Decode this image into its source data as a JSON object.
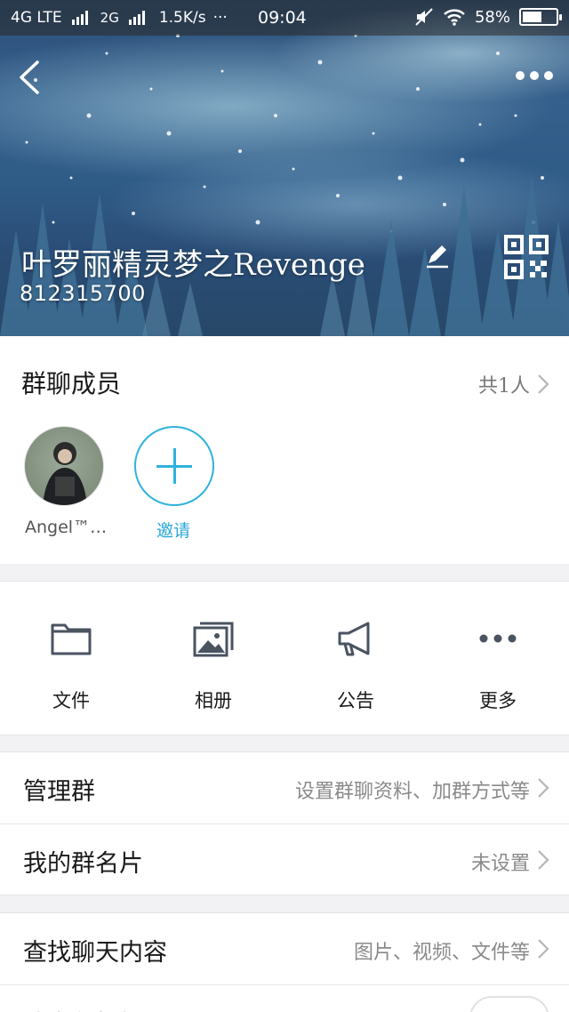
{
  "status_bar": {
    "network1": "4G LTE",
    "network2": "2G",
    "speed": "1.5K/s",
    "dots": "···",
    "time": "09:04",
    "battery": "58%",
    "battery_level": 0.58
  },
  "header": {
    "group_name": "叶罗丽精灵梦之Revenge",
    "group_id": "812315700"
  },
  "members": {
    "title": "群聊成员",
    "count": "共1人",
    "list": [
      {
        "name": "Angel™…"
      }
    ],
    "invite_label": "邀请"
  },
  "actions": [
    {
      "label": "文件",
      "icon": "folder-icon"
    },
    {
      "label": "相册",
      "icon": "photo-album-icon"
    },
    {
      "label": "公告",
      "icon": "megaphone-icon"
    },
    {
      "label": "更多",
      "icon": "more-dots-icon"
    }
  ],
  "settings": {
    "manage": {
      "title": "管理群",
      "value": "设置群聊资料、加群方式等"
    },
    "card": {
      "title": "我的群名片",
      "value": "未设置"
    },
    "search": {
      "title": "查找聊天内容",
      "value": "图片、视频、文件等"
    },
    "notify": {
      "title": "消息免打扰"
    }
  },
  "colors": {
    "accent": "#2fb2de",
    "icon_gray": "#4a5360"
  }
}
